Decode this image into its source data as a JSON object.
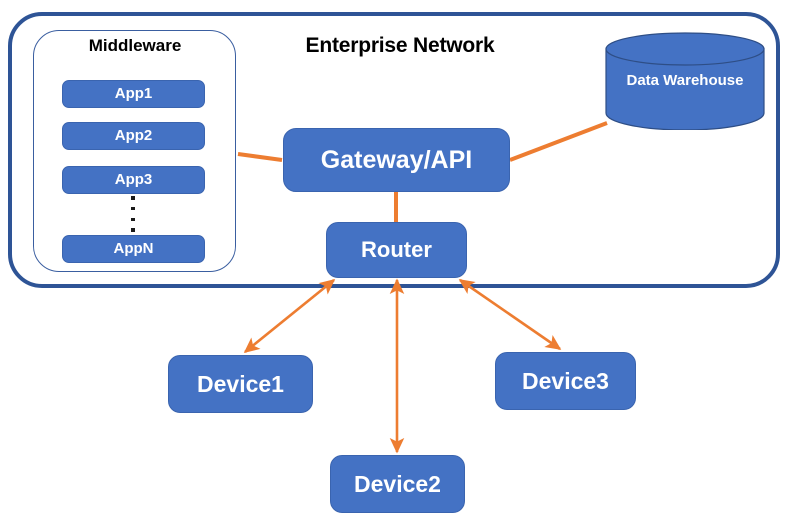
{
  "diagram": {
    "title": "Enterprise Network",
    "enterprise_container_label": "Enterprise Network",
    "middleware_container_label": "Middleware",
    "colors": {
      "node_fill": "#4472C4",
      "node_stroke": "#3A64AF",
      "container_border": "#2E5496",
      "inner_container_border": "#3A5EA0",
      "connector": "#ED7D31",
      "label_text": "#000000",
      "node_text": "#FFFFFF",
      "background": "#FFFFFF"
    },
    "apps": [
      {
        "label": "App1"
      },
      {
        "label": "App2"
      },
      {
        "label": "App3"
      },
      {
        "label": "AppN"
      }
    ],
    "ellipsis_dots": 4,
    "nodes": {
      "gateway": "Gateway/API",
      "router": "Router",
      "warehouse": "Data Warehouse",
      "device1": "Device1",
      "device2": "Device2",
      "device3": "Device3"
    },
    "connections": [
      {
        "from": "Middleware",
        "to": "Gateway/API",
        "arrow": "none"
      },
      {
        "from": "Gateway/API",
        "to": "Data Warehouse",
        "arrow": "none"
      },
      {
        "from": "Gateway/API",
        "to": "Router",
        "arrow": "none"
      },
      {
        "from": "Router",
        "to": "Device1",
        "arrow": "both"
      },
      {
        "from": "Router",
        "to": "Device2",
        "arrow": "both"
      },
      {
        "from": "Router",
        "to": "Device3",
        "arrow": "both"
      }
    ]
  }
}
